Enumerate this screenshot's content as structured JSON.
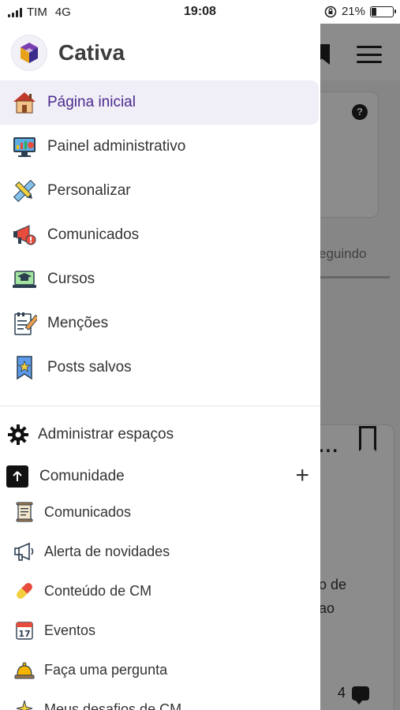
{
  "status_bar": {
    "carrier": "TIM",
    "network": "4G",
    "time": "19:08",
    "battery_percent": "21%",
    "battery_level": 0.21
  },
  "brand": {
    "name": "Cativa"
  },
  "nav": {
    "items": [
      {
        "label": "Página inicial",
        "icon": "house-icon",
        "active": true
      },
      {
        "label": "Painel administrativo",
        "icon": "dashboard-monitor-icon"
      },
      {
        "label": "Personalizar",
        "icon": "pencil-ruler-icon"
      },
      {
        "label": "Comunicados",
        "icon": "megaphone-icon"
      },
      {
        "label": "Cursos",
        "icon": "graduation-laptop-icon"
      },
      {
        "label": "Menções",
        "icon": "notepad-icon"
      },
      {
        "label": "Posts salvos",
        "icon": "bookmark-star-icon"
      }
    ]
  },
  "admin_spaces": {
    "label": "Administrar espaços",
    "icon": "gear-icon"
  },
  "community": {
    "label": "Comunidade",
    "add_symbol": "+",
    "items": [
      {
        "label": "Comunicados",
        "icon": "scroll-icon"
      },
      {
        "label": "Alerta de novidades",
        "icon": "megaphone-outline-icon"
      },
      {
        "label": "Conteúdo de CM",
        "icon": "pill-icon"
      },
      {
        "label": "Eventos",
        "icon": "calendar-icon",
        "day": "17"
      },
      {
        "label": "Faça uma pergunta",
        "icon": "bell-icon"
      },
      {
        "label": "Meus desafios de CM",
        "icon": "sparkle-icon"
      }
    ]
  },
  "background": {
    "help_symbol": "?",
    "tab_fragment": "eguindo",
    "text_fragment_1": "o de",
    "text_fragment_2": "ao",
    "dots": "...",
    "comment_count": "4"
  },
  "colors": {
    "accent": "#4b2a8f",
    "active_bg": "#f0eef6"
  }
}
